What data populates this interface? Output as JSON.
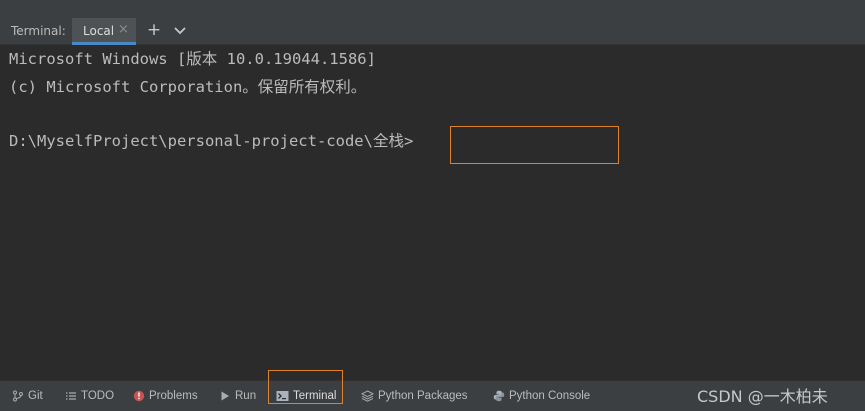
{
  "tabbar": {
    "label": "Terminal:",
    "active_tab": "Local",
    "close_glyph": "×",
    "add_glyph": "+"
  },
  "terminal": {
    "lines": [
      "Microsoft Windows [版本 10.0.19044.1586]",
      "(c) Microsoft Corporation。保留所有权利。",
      "D:\\MyselfProject\\personal-project-code\\全栈>"
    ]
  },
  "statusbar": {
    "items": [
      {
        "label": "Git",
        "icon": "git-branch-icon"
      },
      {
        "label": "TODO",
        "icon": "list-icon"
      },
      {
        "label": "Problems",
        "icon": "error-icon"
      },
      {
        "label": "Run",
        "icon": "play-icon"
      },
      {
        "label": "Terminal",
        "icon": "terminal-icon"
      },
      {
        "label": "Python Packages",
        "icon": "layers-icon"
      },
      {
        "label": "Python Console",
        "icon": "python-icon"
      }
    ],
    "watermark": "CSDN @一木柏未"
  },
  "colors": {
    "background": "#2b2b2b",
    "bar": "#3c3f41",
    "highlight_box": "#e0802b",
    "active_tab_underline": "#4a88c7"
  }
}
